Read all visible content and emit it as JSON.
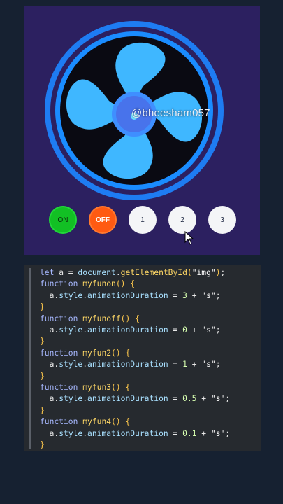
{
  "watermark": "@bheesham057",
  "buttons": {
    "on": "ON",
    "off": "OFF",
    "speed1": "1",
    "speed2": "2",
    "speed3": "3"
  },
  "colors": {
    "stage_bg": "#2c2060",
    "fan_blade": "#3fb7ff",
    "fan_ring": "#1f8cff",
    "on_button": "#12c024",
    "off_button": "#ff5a12",
    "code_bg": "#262a2f"
  },
  "code_lines": [
    "let a = document.getElementById(\"img\");",
    "function myfunon() {",
    "  a.style.animationDuration = 3 + \"s\";",
    "}",
    "function myfunoff() {",
    "  a.style.animationDuration = 0 + \"s\";",
    "}",
    "function myfun2() {",
    "  a.style.animationDuration = 1 + \"s\";",
    "}",
    "function myfun3() {",
    "  a.style.animationDuration = 0.5 + \"s\";",
    "}",
    "function myfun4() {",
    "  a.style.animationDuration = 0.1 + \"s\";",
    "}"
  ]
}
